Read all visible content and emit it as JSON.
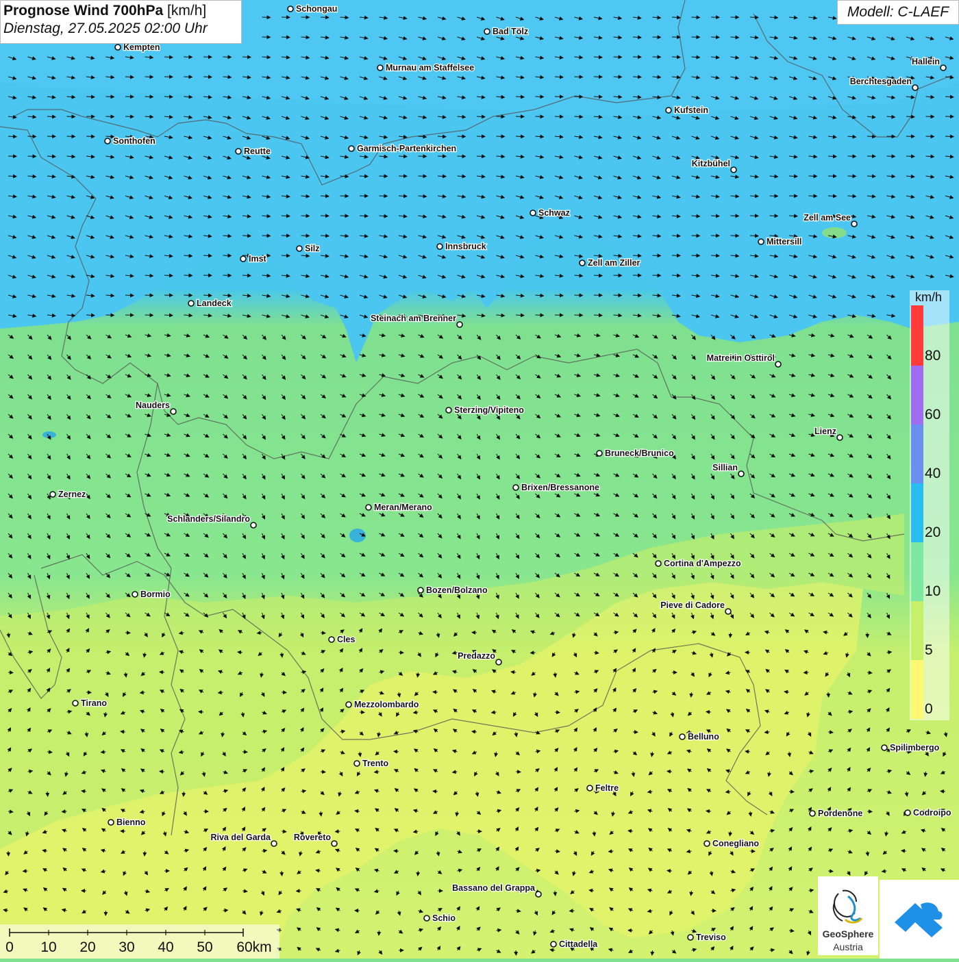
{
  "title": {
    "main_bold": "Prognose Wind 700hPa",
    "main_unit": "[km/h]",
    "subtitle": "Dienstag, 27.05.2025 02:00 Uhr"
  },
  "model": "Modell: C-LAEF",
  "legend": {
    "unit": "km/h",
    "labels": [
      "80",
      "60",
      "40",
      "20",
      "10",
      "5",
      "0"
    ],
    "colors": [
      "#ff3b3b",
      "#a06cf0",
      "#6a8ff0",
      "#29bdf0",
      "#7de8a0",
      "#c6f06a",
      "#fff870",
      "#c0e8f8"
    ]
  },
  "scalebar": {
    "labels": [
      "0",
      "10",
      "20",
      "30",
      "40",
      "50",
      "60km"
    ]
  },
  "logos": {
    "geosphere_line1": "GeoSphere",
    "geosphere_line2": "Austria"
  },
  "cities": [
    {
      "name": "Schongau"
    },
    {
      "name": "Bad Tölz"
    },
    {
      "name": "Kempten"
    },
    {
      "name": "Murnau am Staffelsee"
    },
    {
      "name": "Hallein"
    },
    {
      "name": "Berchtesgaden"
    },
    {
      "name": "Kufstein"
    },
    {
      "name": "Sonthofen"
    },
    {
      "name": "Reutte"
    },
    {
      "name": "Garmisch-Partenkirchen"
    },
    {
      "name": "Kitzbühel"
    },
    {
      "name": "Schwaz"
    },
    {
      "name": "Zell am See"
    },
    {
      "name": "Mittersill"
    },
    {
      "name": "Innsbruck"
    },
    {
      "name": "Silz"
    },
    {
      "name": "Imst"
    },
    {
      "name": "Zell am Ziller"
    },
    {
      "name": "Landeck"
    },
    {
      "name": "Steinach am Brenner"
    },
    {
      "name": "Matrei in Osttirol"
    },
    {
      "name": "Nauders"
    },
    {
      "name": "Sterzing/Vipiteno"
    },
    {
      "name": "Lienz"
    },
    {
      "name": "Bruneck/Brunico"
    },
    {
      "name": "Sillian"
    },
    {
      "name": "Zernez"
    },
    {
      "name": "Brixen/Bressanone"
    },
    {
      "name": "Meran/Merano"
    },
    {
      "name": "Schlanders/Silandro"
    },
    {
      "name": "Cortina d'Ampezzo"
    },
    {
      "name": "Bozen/Bolzano"
    },
    {
      "name": "Bormio"
    },
    {
      "name": "Pieve di Cadore"
    },
    {
      "name": "Cles"
    },
    {
      "name": "Predazzo"
    },
    {
      "name": "Tirano"
    },
    {
      "name": "Mezzolombardo"
    },
    {
      "name": "Belluno"
    },
    {
      "name": "Spilimbergo"
    },
    {
      "name": "Trento"
    },
    {
      "name": "Feltre"
    },
    {
      "name": "Pordenone"
    },
    {
      "name": "Codroipo"
    },
    {
      "name": "Bienno"
    },
    {
      "name": "Riva del Garda"
    },
    {
      "name": "Rovereto"
    },
    {
      "name": "Conegliano"
    },
    {
      "name": "Bassano del Grappa"
    },
    {
      "name": "Schio"
    },
    {
      "name": "Treviso"
    },
    {
      "name": "Cittadella"
    }
  ]
}
